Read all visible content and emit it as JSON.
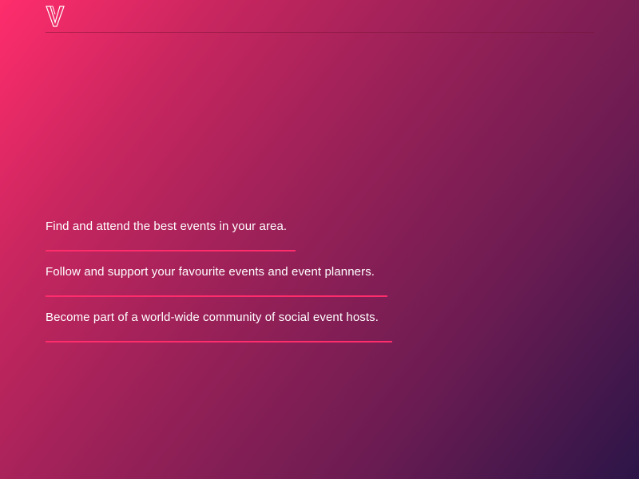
{
  "brand": {
    "logo_icon": "v-logo-icon",
    "accent_color": "#ff2d6c"
  },
  "features": [
    {
      "text": "Find and attend the best events in your area."
    },
    {
      "text": "Follow and support your favourite events and event planners."
    },
    {
      "text": "Become part of a world-wide community of social event hosts."
    }
  ]
}
